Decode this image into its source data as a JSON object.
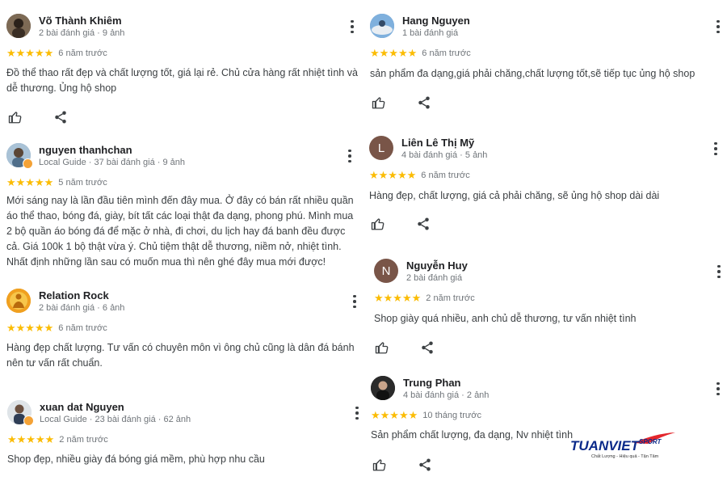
{
  "reviews": [
    {
      "name": "Võ Thành Khiêm",
      "meta": "2 bài đánh giá · 9 ảnh",
      "time": "6 năm trước",
      "stars": 5,
      "text": "Đồ thể thao rất đẹp và chất lượng tốt, giá lại rẻ. Chủ cửa hàng rất nhiệt tình và dễ thương. Ủng hộ shop"
    },
    {
      "name": "nguyen thanhchan",
      "meta": "Local Guide · 37 bài đánh giá · 9 ảnh",
      "time": "5 năm trước",
      "stars": 5,
      "text": "Mới sáng nay là lần đầu tiên mình đến đây mua. Ở đây có bán rất nhiều quần áo thể thao, bóng đá, giày, bít tất các loại thật đa dạng, phong phú. Mình mua 2 bộ quần áo bóng đá để mặc ở nhà, đi chơi, du lịch hay đá banh đều được cả. Giá 100k 1 bộ thật vừa ý. Chủ tiệm thật dễ thương, niềm nở, nhiệt tình. Nhất định những lần sau có muốn mua thì nên ghé đây mua mới được!"
    },
    {
      "name": "Relation Rock",
      "meta": "2 bài đánh giá · 6 ảnh",
      "time": "6 năm trước",
      "stars": 5,
      "text": "Hàng đẹp chất lượng. Tư vấn có chuyên môn vì ông chủ cũng là dân đá bánh nên tư vấn rất chuẩn."
    },
    {
      "name": "xuan dat Nguyen",
      "meta": "Local Guide · 23 bài đánh giá · 62 ảnh",
      "time": "2 năm trước",
      "stars": 5,
      "text": "Shop đẹp, nhiều giày đá bóng giá mềm, phù hợp nhu cầu"
    },
    {
      "name": "Hang Nguyen",
      "meta": "1 bài đánh giá",
      "time": "6 năm trước",
      "stars": 5,
      "text": "sản phẩm đa dạng,giá phải chăng,chất lượng tốt,sẽ tiếp tục ủng hộ shop"
    },
    {
      "name": "Liên Lê Thị Mỹ",
      "meta": "4 bài đánh giá · 5 ảnh",
      "time": "6 năm trước",
      "stars": 5,
      "initial": "L",
      "text": "Hàng đẹp, chất lượng, giá cả phải chăng, sẽ ủng hộ shop dài dài"
    },
    {
      "name": "Nguyễn Huy",
      "meta": "2 bài đánh giá",
      "time": "2 năm trước",
      "stars": 5,
      "initial": "N",
      "text": "Shop giày quá nhiều, anh chủ dễ thương, tư vấn nhiệt tình"
    },
    {
      "name": "Trung Phan",
      "meta": "4 bài đánh giá · 2 ảnh",
      "time": "10 tháng trước",
      "stars": 5,
      "text": "Sản phẩm chất lượng, đa dạng, Nv nhiệt tình"
    }
  ],
  "star_glyphs": "★★★★★",
  "logo": {
    "brand": "TUANVIET",
    "sub": "SPORT",
    "tagline": "Chất Lượng - Hiệu quả - Tận Tâm"
  },
  "colors": {
    "star": "#fbbc04",
    "brand": "#0b2a8a",
    "brand_accent": "#e3262c"
  }
}
